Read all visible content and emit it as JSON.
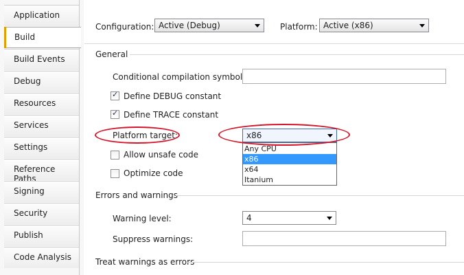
{
  "tabs": [
    "Application",
    "Build",
    "Build Events",
    "Debug",
    "Resources",
    "Services",
    "Settings",
    "Reference Paths",
    "Signing",
    "Security",
    "Publish",
    "Code Analysis"
  ],
  "active_tab": "Build",
  "config": {
    "configuration_label": "Configuration:",
    "configuration_value": "Active (Debug)",
    "platform_label": "Platform:",
    "platform_value": "Active (x86)"
  },
  "general": {
    "title": "General",
    "conditional_symbols_label": "Conditional compilation symbols:",
    "conditional_symbols_value": "",
    "define_debug_label": "Define DEBUG constant",
    "define_debug_checked": true,
    "define_trace_label": "Define TRACE constant",
    "define_trace_checked": true,
    "platform_target_label": "Platform target:",
    "platform_target_value": "x86",
    "platform_target_options": [
      "Any CPU",
      "x86",
      "x64",
      "Itanium"
    ],
    "platform_target_selected_index": 1,
    "allow_unsafe_label": "Allow unsafe code",
    "allow_unsafe_checked": false,
    "optimize_label": "Optimize code",
    "optimize_checked": false
  },
  "errors": {
    "title": "Errors and warnings",
    "warning_level_label": "Warning level:",
    "warning_level_value": "4",
    "suppress_label": "Suppress warnings:",
    "suppress_value": ""
  },
  "treat_warnings": {
    "title": "Treat warnings as errors"
  },
  "annotation_color": "#d3152a",
  "selection_color": "#3399ff",
  "active_tab_accent": "#e2a000"
}
